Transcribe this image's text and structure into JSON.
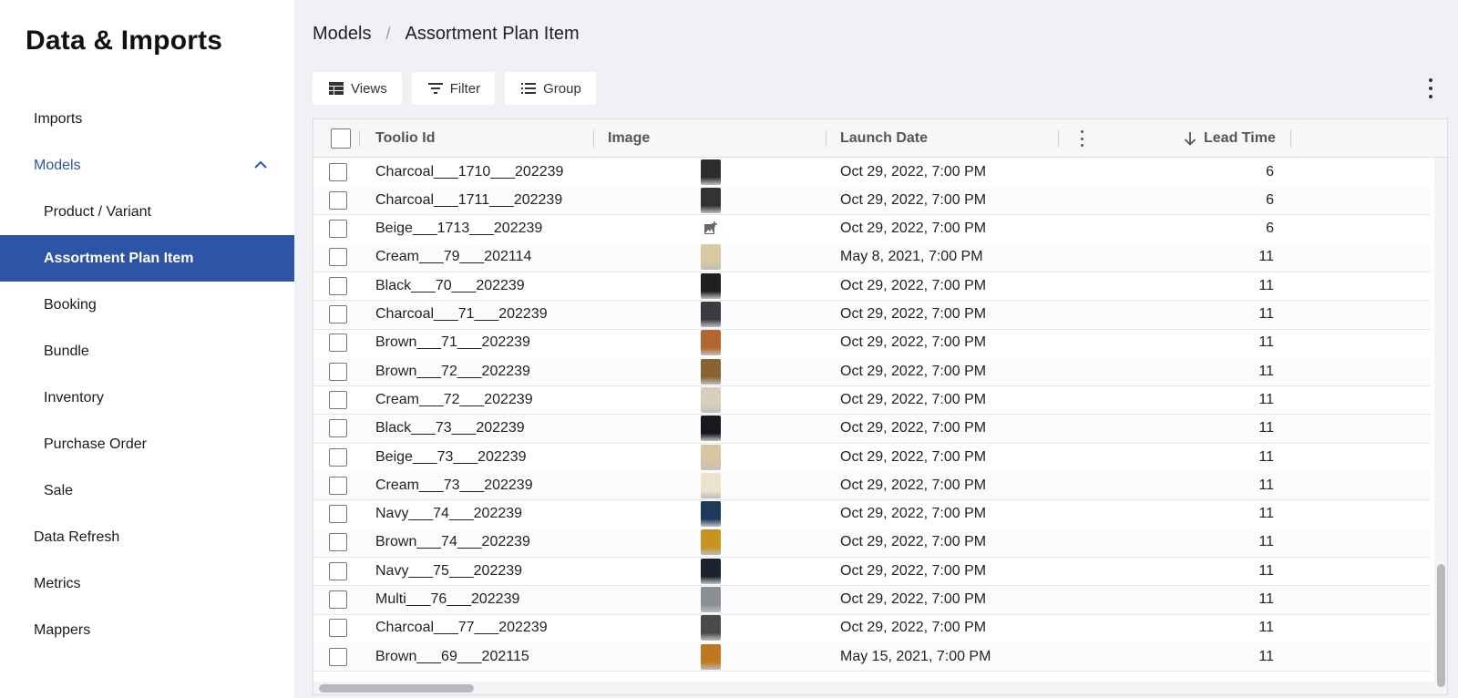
{
  "sidebar": {
    "title": "Data & Imports",
    "items": [
      {
        "label": "Imports",
        "level": 0,
        "state": "normal",
        "name": "sidebar-item-imports"
      },
      {
        "label": "Models",
        "level": 0,
        "state": "expanded",
        "name": "sidebar-item-models"
      },
      {
        "label": "Product / Variant",
        "level": 1,
        "state": "normal",
        "name": "sidebar-item-product-variant"
      },
      {
        "label": "Assortment Plan Item",
        "level": 1,
        "state": "active",
        "name": "sidebar-item-assortment-plan-item"
      },
      {
        "label": "Booking",
        "level": 1,
        "state": "normal",
        "name": "sidebar-item-booking"
      },
      {
        "label": "Bundle",
        "level": 1,
        "state": "normal",
        "name": "sidebar-item-bundle"
      },
      {
        "label": "Inventory",
        "level": 1,
        "state": "normal",
        "name": "sidebar-item-inventory"
      },
      {
        "label": "Purchase Order",
        "level": 1,
        "state": "normal",
        "name": "sidebar-item-purchase-order"
      },
      {
        "label": "Sale",
        "level": 1,
        "state": "normal",
        "name": "sidebar-item-sale"
      },
      {
        "label": "Data Refresh",
        "level": 0,
        "state": "normal",
        "name": "sidebar-item-data-refresh"
      },
      {
        "label": "Metrics",
        "level": 0,
        "state": "normal",
        "name": "sidebar-item-metrics"
      },
      {
        "label": "Mappers",
        "level": 0,
        "state": "normal",
        "name": "sidebar-item-mappers"
      }
    ]
  },
  "breadcrumb": {
    "parent": "Models",
    "separator": "/",
    "current": "Assortment Plan Item"
  },
  "toolbar": {
    "views_label": "Views",
    "filter_label": "Filter",
    "group_label": "Group"
  },
  "table": {
    "columns": {
      "id": "Toolio Id",
      "image": "Image",
      "launch_date": "Launch Date",
      "lead_time": "Lead Time"
    },
    "sort": {
      "column": "lead_time",
      "direction": "descending-arrow"
    },
    "rows": [
      {
        "id": "Charcoal___1710___202239",
        "thumb": "#2c2c2e",
        "date": "Oct 29, 2022, 7:00 PM",
        "lead": "6"
      },
      {
        "id": "Charcoal___1711___202239",
        "thumb": "#333336",
        "date": "Oct 29, 2022, 7:00 PM",
        "lead": "6"
      },
      {
        "id": "Beige___1713___202239",
        "thumb": "placeholder",
        "date": "Oct 29, 2022, 7:00 PM",
        "lead": "6"
      },
      {
        "id": "Cream___79___202114",
        "thumb": "#d9c9a3",
        "date": "May 8, 2021, 7:00 PM",
        "lead": "11"
      },
      {
        "id": "Black___70___202239",
        "thumb": "#1f1f21",
        "date": "Oct 29, 2022, 7:00 PM",
        "lead": "11"
      },
      {
        "id": "Charcoal___71___202239",
        "thumb": "#3a3b3e",
        "date": "Oct 29, 2022, 7:00 PM",
        "lead": "11"
      },
      {
        "id": "Brown___71___202239",
        "thumb": "#b5652e",
        "date": "Oct 29, 2022, 7:00 PM",
        "lead": "11"
      },
      {
        "id": "Brown___72___202239",
        "thumb": "#8a6430",
        "date": "Oct 29, 2022, 7:00 PM",
        "lead": "11"
      },
      {
        "id": "Cream___72___202239",
        "thumb": "#d8cfb8",
        "date": "Oct 29, 2022, 7:00 PM",
        "lead": "11"
      },
      {
        "id": "Black___73___202239",
        "thumb": "#18191c",
        "date": "Oct 29, 2022, 7:00 PM",
        "lead": "11"
      },
      {
        "id": "Beige___73___202239",
        "thumb": "#d7c5a2",
        "date": "Oct 29, 2022, 7:00 PM",
        "lead": "11"
      },
      {
        "id": "Cream___73___202239",
        "thumb": "#ede3cc",
        "date": "Oct 29, 2022, 7:00 PM",
        "lead": "11"
      },
      {
        "id": "Navy___74___202239",
        "thumb": "#1d3b5c",
        "date": "Oct 29, 2022, 7:00 PM",
        "lead": "11"
      },
      {
        "id": "Brown___74___202239",
        "thumb": "#c89420",
        "date": "Oct 29, 2022, 7:00 PM",
        "lead": "11"
      },
      {
        "id": "Navy___75___202239",
        "thumb": "#1b2230",
        "date": "Oct 29, 2022, 7:00 PM",
        "lead": "11"
      },
      {
        "id": "Multi___76___202239",
        "thumb": "#8c8f96",
        "date": "Oct 29, 2022, 7:00 PM",
        "lead": "11"
      },
      {
        "id": "Charcoal___77___202239",
        "thumb": "#4a4a4d",
        "date": "Oct 29, 2022, 7:00 PM",
        "lead": "11"
      },
      {
        "id": "Brown___69___202115",
        "thumb": "#c0781e",
        "date": "May 15, 2021, 7:00 PM",
        "lead": "11"
      }
    ]
  },
  "colors": {
    "accent": "#2e55a5",
    "expanded_text": "#2d55a7",
    "page_bg": "#f0f1f5"
  }
}
